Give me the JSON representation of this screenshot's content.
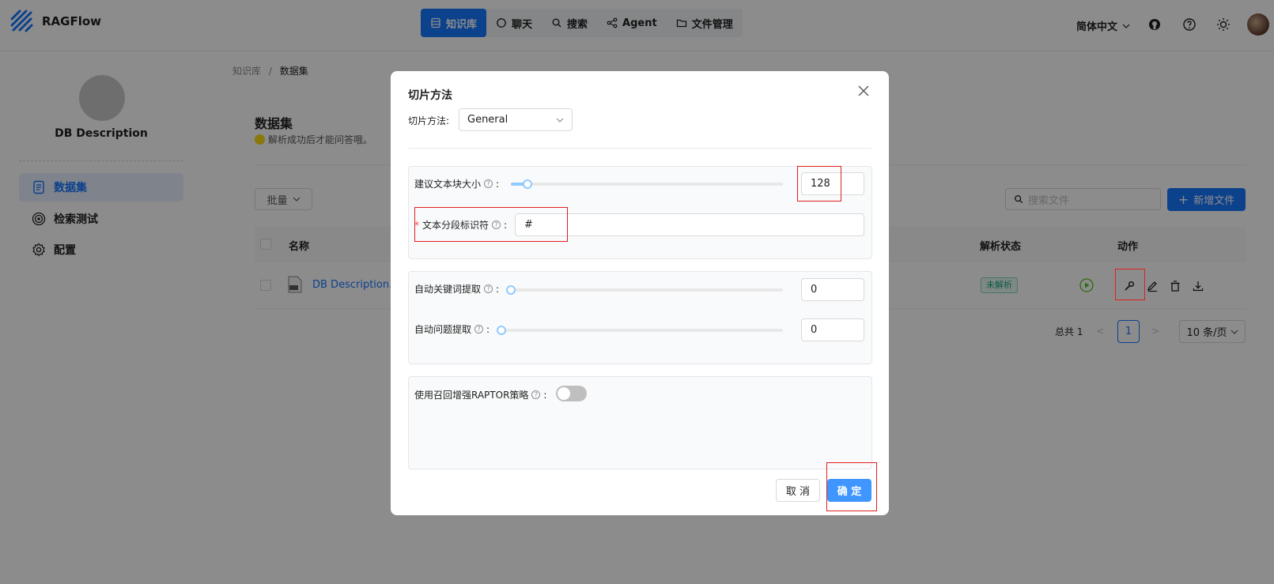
{
  "header": {
    "brand": "RAGFlow",
    "nav": [
      {
        "label": "知识库",
        "icon": "database-icon",
        "active": true
      },
      {
        "label": "聊天",
        "icon": "chat-icon",
        "active": false
      },
      {
        "label": "搜索",
        "icon": "search-icon",
        "active": false
      },
      {
        "label": "Agent",
        "icon": "agent-icon",
        "active": false
      },
      {
        "label": "文件管理",
        "icon": "folder-icon",
        "active": false
      }
    ],
    "language": "简体中文"
  },
  "sidebar": {
    "kb_name": "DB Description",
    "items": [
      {
        "label": "数据集",
        "icon": "document-icon",
        "active": true
      },
      {
        "label": "检索测试",
        "icon": "target-icon",
        "active": false
      },
      {
        "label": "配置",
        "icon": "gear-icon",
        "active": false
      }
    ]
  },
  "breadcrumb": {
    "root": "知识库",
    "separator": "/",
    "current": "数据集"
  },
  "main": {
    "title": "数据集",
    "subtitle": "解析成功后才能问答哦。",
    "batch_label": "批量",
    "search_placeholder": "搜索文件",
    "add_file_label": "新增文件",
    "columns": {
      "name": "名称",
      "status": "解析状态",
      "action": "动作"
    },
    "rows": [
      {
        "name": "DB Description.txt",
        "display_name": "DB Description.t",
        "status": "未解析"
      }
    ],
    "pagination": {
      "total": "总共 1",
      "page": "1",
      "page_size": "10 条/页"
    }
  },
  "modal": {
    "title": "切片方法",
    "method_label": "切片方法:",
    "method_value": "General",
    "chunk_size_label": "建议文本块大小",
    "chunk_size_value": "128",
    "chunk_size_fraction": 0.06,
    "delimiter_label": "文本分段标识符",
    "delimiter_required_mark": "*",
    "delimiter_value": "#",
    "auto_keywords_label": "自动关键词提取",
    "auto_keywords_value": "0",
    "auto_questions_label": "自动问题提取",
    "auto_questions_value": "0",
    "raptor_label": "使用召回增强RAPTOR策略",
    "raptor_enabled": false,
    "cancel_label": "取 消",
    "ok_label": "确 定"
  },
  "colors": {
    "primary": "#1677ff",
    "highlight": "#e02020",
    "overlay": "rgba(0,0,0,0.45)"
  }
}
